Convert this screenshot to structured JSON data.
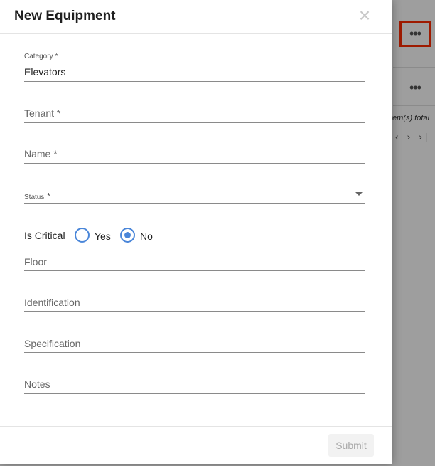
{
  "background": {
    "row_menu_1": "•••",
    "row_menu_2": "•••",
    "total_text": "tem(s) total",
    "pager": "‹ › ›|"
  },
  "dialog": {
    "title": "New Equipment",
    "close_icon": "×",
    "category": {
      "label": "Category *",
      "value": "Elevators"
    },
    "tenant": {
      "label": "Tenant *",
      "value": ""
    },
    "name": {
      "label": "Name *",
      "value": ""
    },
    "status": {
      "label": "Status",
      "required_mark": " *",
      "value": ""
    },
    "is_critical": {
      "label": "Is Critical",
      "options": [
        {
          "label": "Yes",
          "selected": false
        },
        {
          "label": "No",
          "selected": true
        }
      ]
    },
    "floor": {
      "label": "Floor",
      "value": ""
    },
    "identification": {
      "label": "Identification",
      "value": ""
    },
    "specification": {
      "label": "Specification",
      "value": ""
    },
    "notes": {
      "label": "Notes",
      "value": ""
    },
    "submit_label": "Submit"
  },
  "colors": {
    "accent": "#4a86d9",
    "highlight": "#ff2a00",
    "overlay": "#9e9e9e"
  }
}
